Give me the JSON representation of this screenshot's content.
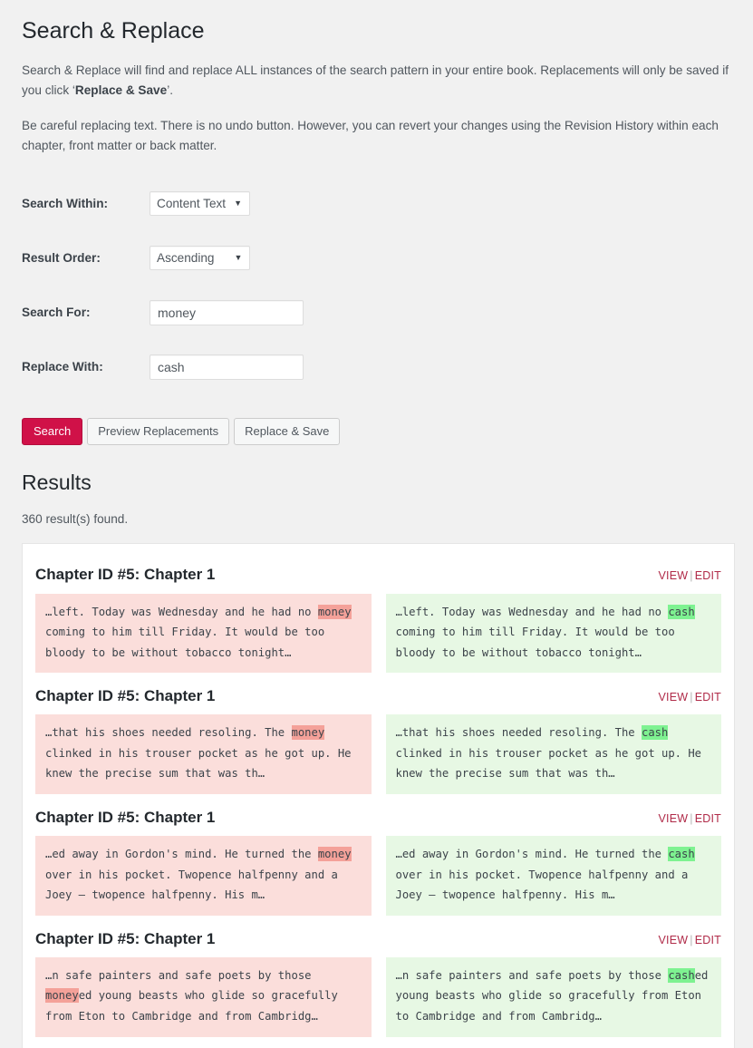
{
  "header": {
    "title": "Search & Replace",
    "intro_1_pre": "Search & Replace will find and replace ALL instances of the search pattern in your entire book. Replacements will only be saved if you click ‘",
    "intro_1_strong": "Replace & Save",
    "intro_1_post": "’.",
    "intro_2": "Be careful replacing text. There is no undo button. However, you can revert your changes using the Revision History within each chapter, front matter or back matter."
  },
  "form": {
    "search_within": {
      "label": "Search Within:",
      "value": "Content Text",
      "caret": "▼"
    },
    "result_order": {
      "label": "Result Order:",
      "value": "Ascending",
      "caret": "▼"
    },
    "search_for": {
      "label": "Search For:",
      "value": "money",
      "placeholder": ""
    },
    "replace_with": {
      "label": "Replace With:",
      "value": "cash",
      "placeholder": ""
    },
    "buttons": {
      "search": "Search",
      "preview": "Preview Replacements",
      "replace_save": "Replace & Save"
    }
  },
  "results": {
    "title": "Results",
    "count_text": "360 result(s) found.",
    "view_label": "VIEW",
    "separator": "|",
    "edit_label": "EDIT",
    "items": [
      {
        "chapter": "Chapter ID #5: Chapter 1",
        "before_pre": "…left. Today was Wednesday and he had no ",
        "before_mark": "money",
        "before_post": " coming to him till Friday. It would be too bloody to be without tobacco tonight…",
        "after_pre": "…left. Today was Wednesday and he had no ",
        "after_mark": "cash",
        "after_post": " coming to him till Friday. It would be too bloody to be without tobacco tonight…"
      },
      {
        "chapter": "Chapter ID #5: Chapter 1",
        "before_pre": "…that his shoes needed resoling. The ",
        "before_mark": "money",
        "before_post": " clinked in his trouser pocket as he got up. He knew the precise sum that was th…",
        "after_pre": "…that his shoes needed resoling. The ",
        "after_mark": "cash",
        "after_post": " clinked in his trouser pocket as he got up. He knew the precise sum that was th…"
      },
      {
        "chapter": "Chapter ID #5: Chapter 1",
        "before_pre": "…ed away in Gordon's mind. He turned the ",
        "before_mark": "money",
        "before_post": " over in his pocket. Twopence halfpenny and a Joey — twopence halfpenny. His m…",
        "after_pre": "…ed away in Gordon's mind. He turned the ",
        "after_mark": "cash",
        "after_post": " over in his pocket. Twopence halfpenny and a Joey — twopence halfpenny. His m…"
      },
      {
        "chapter": "Chapter ID #5: Chapter 1",
        "before_pre": "…n safe painters and safe poets by those ",
        "before_mark": "money",
        "before_post": "ed young beasts who glide so gracefully from Eton to Cambridge and from Cambridg…",
        "after_pre": "…n safe painters and safe poets by those ",
        "after_mark": "cash",
        "after_post": "ed young beasts who glide so gracefully from Eton to Cambridge and from Cambridg…"
      }
    ]
  },
  "colors": {
    "primary_button": "#d01148",
    "link": "#b02a48",
    "page_background": "#f1f1f1",
    "snippet_before_bg": "#fbdedb",
    "snippet_after_bg": "#e7f8e4",
    "highlight_before": "#f4a199",
    "highlight_after": "#7ef291"
  }
}
